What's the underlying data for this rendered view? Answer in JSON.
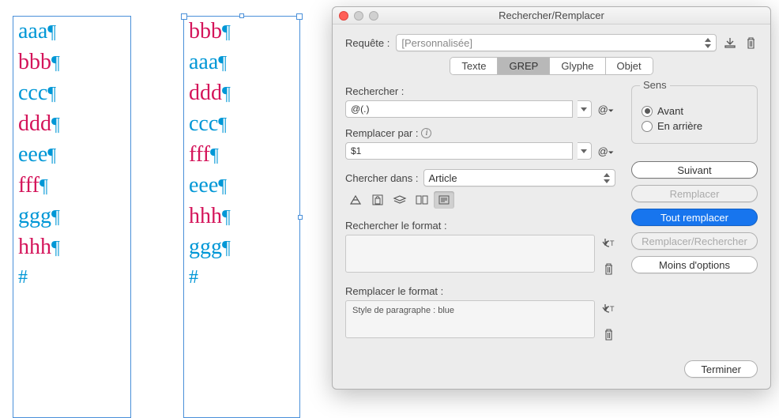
{
  "frames": {
    "col1": [
      {
        "text": "aaa",
        "cls": "blue-text"
      },
      {
        "text": "bbb",
        "cls": "red-text"
      },
      {
        "text": "ccc",
        "cls": "blue-text"
      },
      {
        "text": "ddd",
        "cls": "red-text"
      },
      {
        "text": "eee",
        "cls": "blue-text"
      },
      {
        "text": "fff",
        "cls": "red-text"
      },
      {
        "text": "ggg",
        "cls": "blue-text"
      },
      {
        "text": "hhh",
        "cls": "red-text"
      }
    ],
    "col2": [
      {
        "text": "bbb",
        "cls": "red-text"
      },
      {
        "text": "aaa",
        "cls": "blue-text"
      },
      {
        "text": "ddd",
        "cls": "red-text"
      },
      {
        "text": "ccc",
        "cls": "blue-text"
      },
      {
        "text": "fff",
        "cls": "red-text"
      },
      {
        "text": "eee",
        "cls": "blue-text"
      },
      {
        "text": "hhh",
        "cls": "red-text"
      },
      {
        "text": "ggg",
        "cls": "blue-text"
      }
    ],
    "endmark": "#"
  },
  "dialog": {
    "title": "Rechercher/Remplacer",
    "query_label": "Requête :",
    "query_value": "[Personnalisée]",
    "tabs": [
      "Texte",
      "GREP",
      "Glyphe",
      "Objet"
    ],
    "active_tab": 1,
    "find_label": "Rechercher :",
    "find_value": "@(.)",
    "replace_label": "Remplacer par :",
    "replace_value": "$1",
    "scope_label": "Chercher dans :",
    "scope_value": "Article",
    "find_format_label": "Rechercher le format :",
    "find_format_value": "",
    "replace_format_label": "Remplacer le format :",
    "replace_format_value": "Style de paragraphe : blue",
    "direction": {
      "legend": "Sens",
      "fwd": "Avant",
      "back": "En arrière",
      "selected": "fwd"
    },
    "buttons": {
      "next": "Suivant",
      "replace": "Remplacer",
      "replaceAll": "Tout remplacer",
      "replaceFind": "Remplacer/Rechercher",
      "lessOpts": "Moins d'options",
      "done": "Terminer"
    }
  }
}
